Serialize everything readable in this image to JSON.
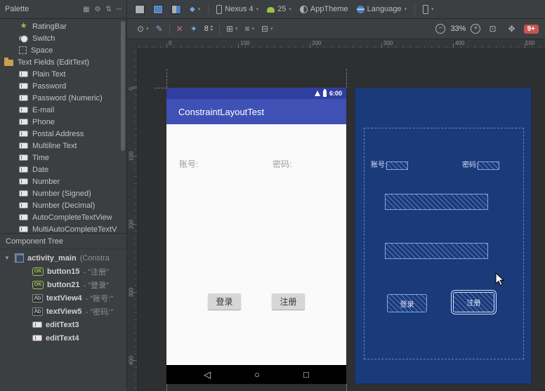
{
  "colors": {
    "app_bar": "#3f51b5",
    "status_bar": "#303f9f",
    "blueprint_bg": "#1b3a7a",
    "error_badge": "#c75450"
  },
  "icon_glyphs": {
    "ratingbar": "★",
    "button_ok": "OK",
    "textview_ab": "Ab",
    "eye": "⊙",
    "brush": "✎",
    "clear": "✕",
    "infer": "✦",
    "pack": "⊞",
    "align": "≡",
    "guideline": "⊟",
    "zoom_out": "−",
    "zoom_in": "+",
    "zoom_fit": "⊡",
    "pan": "✥",
    "back": "◁",
    "home": "○",
    "recents": "□",
    "dropdown": "▾",
    "expand": "▼",
    "stepper_up": "▴",
    "stepper_down": "▾",
    "gear": "⚙",
    "grid": "▦",
    "sort": "⇅",
    "minimize": "─",
    "diamond": "◆"
  },
  "palette_panel": {
    "title": "Palette",
    "items": [
      {
        "label": "RatingBar"
      },
      {
        "label": "Switch"
      },
      {
        "label": "Space"
      },
      {
        "label": "Text Fields (EditText)"
      },
      {
        "label": "Plain Text"
      },
      {
        "label": "Password"
      },
      {
        "label": "Password (Numeric)"
      },
      {
        "label": "E-mail"
      },
      {
        "label": "Phone"
      },
      {
        "label": "Postal Address"
      },
      {
        "label": "Multiline Text"
      },
      {
        "label": "Time"
      },
      {
        "label": "Date"
      },
      {
        "label": "Number"
      },
      {
        "label": "Number (Signed)"
      },
      {
        "label": "Number (Decimal)"
      },
      {
        "label": "AutoCompleteTextView"
      },
      {
        "label": "MultiAutoCompleteTextV"
      }
    ]
  },
  "component_tree": {
    "title": "Component Tree",
    "root_name": "activity_main",
    "root_suffix": "(Constra",
    "children": [
      {
        "name": "button15",
        "suffix": "- \"注册\""
      },
      {
        "name": "button21",
        "suffix": "- \"登录\""
      },
      {
        "name": "textView4",
        "suffix": "- \"账号:\""
      },
      {
        "name": "textView5",
        "suffix": "- \"密码:\""
      },
      {
        "name": "editText3",
        "suffix": ""
      },
      {
        "name": "editText4",
        "suffix": ""
      }
    ]
  },
  "main_toolbar": {
    "device": "Nexus 4",
    "api_level": "25",
    "theme": "AppTheme",
    "language": "Language"
  },
  "design_toolbar": {
    "default_margin": "8",
    "zoom_level": "33%",
    "error_count": "9+"
  },
  "rulers": {
    "horizontal": [
      "0",
      "100",
      "200",
      "300",
      "400",
      "500"
    ],
    "vertical": [
      "0",
      "100",
      "200",
      "300",
      "400"
    ]
  },
  "design_view": {
    "status_time": "6:00",
    "app_bar_title": "ConstraintLayoutTest",
    "account_label": "账号:",
    "password_label": "密码:",
    "login_button": "登录",
    "register_button": "注册"
  },
  "blueprint_view": {
    "account_label": "账号:",
    "password_label": "密码:",
    "login_button": "登录",
    "register_button": "注册"
  }
}
